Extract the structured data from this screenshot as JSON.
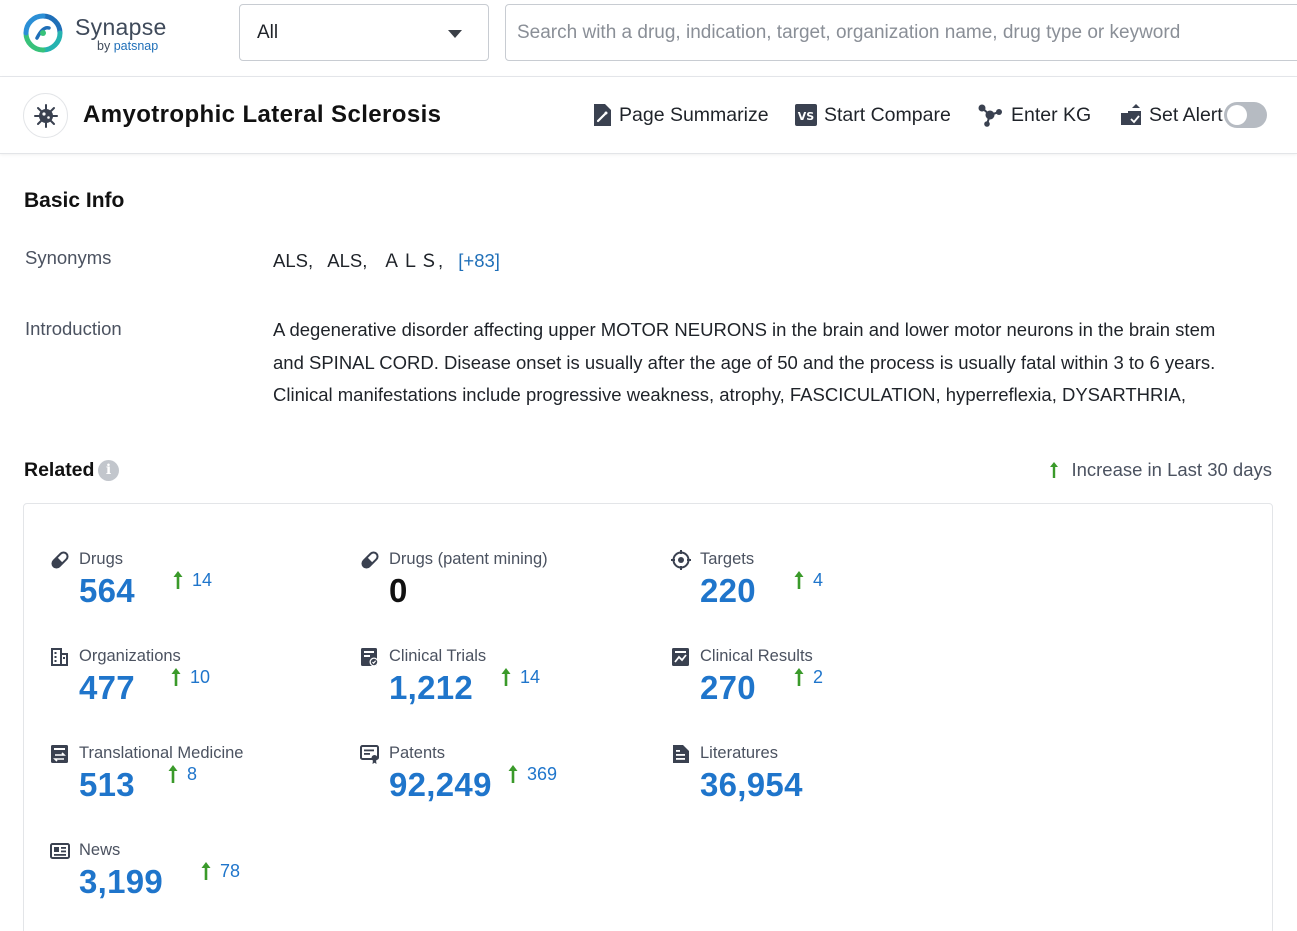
{
  "brand": {
    "name": "Synapse",
    "by": "by",
    "by_brand": "patsnap"
  },
  "search": {
    "scope": "All",
    "placeholder": "Search with a drug, indication, target, organization name, drug type or keyword"
  },
  "header": {
    "title": "Amyotrophic Lateral Sclerosis",
    "actions": {
      "summarize": "Page Summarize",
      "compare": "Start Compare",
      "kg": "Enter KG",
      "alert": "Set Alert"
    },
    "alert_enabled": false
  },
  "basic_info": {
    "heading": "Basic Info",
    "synonyms_label": "Synonyms",
    "synonyms": [
      "ALS,",
      "ALS,",
      "ＡＬＳ,"
    ],
    "synonyms_more": "[+83]",
    "intro_label": "Introduction",
    "intro_lines": [
      "A degenerative disorder affecting upper MOTOR NEURONS in the brain and lower motor neurons in the brain stem",
      "and SPINAL CORD. Disease onset is usually after the age of 50 and the process is usually fatal within 3 to 6 years.",
      "Clinical manifestations include progressive weakness, atrophy, FASCICULATION, hyperreflexia, DYSARTHRIA,"
    ]
  },
  "related": {
    "heading": "Related",
    "legend": "Increase in Last 30 days",
    "accent": "#1f75cb",
    "increase_color": "#3a9a2a",
    "items": [
      {
        "label": "Drugs",
        "value": "564",
        "increase": "14",
        "icon": "pill-icon"
      },
      {
        "label": "Drugs (patent mining)",
        "value": "0",
        "increase": "",
        "icon": "pill-icon"
      },
      {
        "label": "Targets",
        "value": "220",
        "increase": "4",
        "icon": "target-icon"
      },
      {
        "label": "Organizations",
        "value": "477",
        "increase": "10",
        "icon": "building-icon"
      },
      {
        "label": "Clinical Trials",
        "value": "1,212",
        "increase": "14",
        "icon": "clipboard-icon"
      },
      {
        "label": "Clinical Results",
        "value": "270",
        "increase": "2",
        "icon": "chart-doc-icon"
      },
      {
        "label": "Translational Medicine",
        "value": "513",
        "increase": "8",
        "icon": "translational-icon"
      },
      {
        "label": "Patents",
        "value": "92,249",
        "increase": "369",
        "icon": "patent-icon"
      },
      {
        "label": "Literatures",
        "value": "36,954",
        "increase": "",
        "icon": "document-icon"
      },
      {
        "label": "News",
        "value": "3,199",
        "increase": "78",
        "icon": "news-icon"
      }
    ]
  }
}
